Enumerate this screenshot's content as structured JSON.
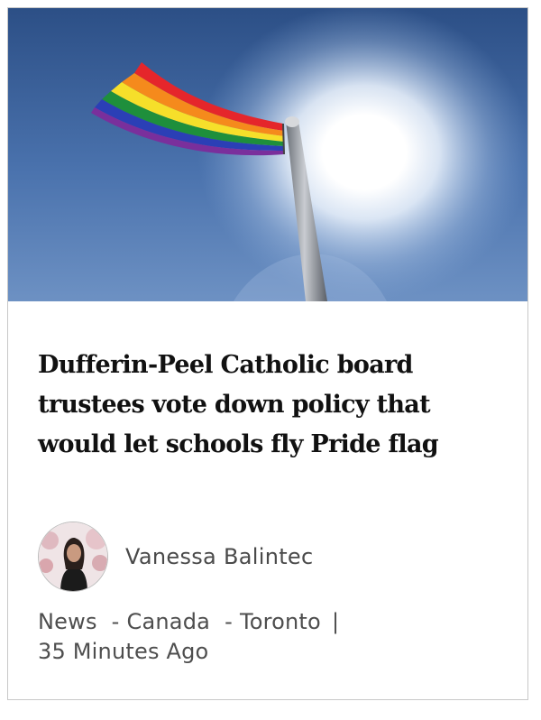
{
  "article": {
    "headline": "Dufferin-Peel Catholic board trustees vote down policy that would let schools fly Pride flag",
    "author": "Vanessa Balintec",
    "categories": [
      "News",
      "Canada",
      "Toronto"
    ],
    "separator": "-",
    "divider": "|",
    "timestamp": "35 Minutes Ago"
  }
}
